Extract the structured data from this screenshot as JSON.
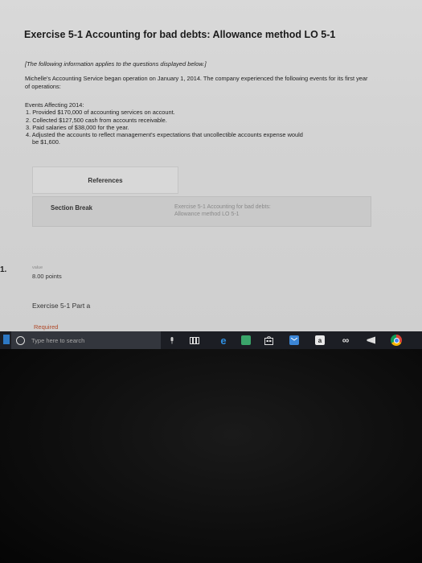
{
  "page": {
    "title": "Exercise 5-1 Accounting for bad debts: Allowance method LO 5-1",
    "intro": "[The following information applies to the questions displayed below.]",
    "paragraph": "Michelle's Accounting Service began operation on January 1, 2014. The company experienced the following events for its first year of operations:",
    "events_heading": "Events Affecting 2014:",
    "events": [
      "1. Provided $170,000 of accounting services on account.",
      "2. Collected $127,500 cash from accounts receivable.",
      "3. Paid salaries of $38,000 for the year.",
      "4. Adjusted the accounts to reflect management's expectations that uncollectible accounts expense would"
    ],
    "event4_cont": "be $1,600."
  },
  "references_button": "References",
  "section_break": {
    "label": "Section Break",
    "right_line1": "Exercise 5-1 Accounting for bad debts:",
    "right_line2": "Allowance method LO 5-1"
  },
  "question": {
    "marker": "1.",
    "value_label": "value",
    "points": "8.00 points",
    "part_title": "Exercise 5-1 Part a",
    "required": "Required"
  },
  "taskbar": {
    "search_placeholder": "Type here to search",
    "icons": [
      "mic-icon",
      "task-view-icon",
      "edge-icon",
      "photos-icon",
      "store-icon",
      "mail-icon",
      "amazon-icon",
      "infinity-icon",
      "feedback-icon",
      "chrome-icon"
    ],
    "amazon_letter": "a",
    "infinity": "∞"
  }
}
